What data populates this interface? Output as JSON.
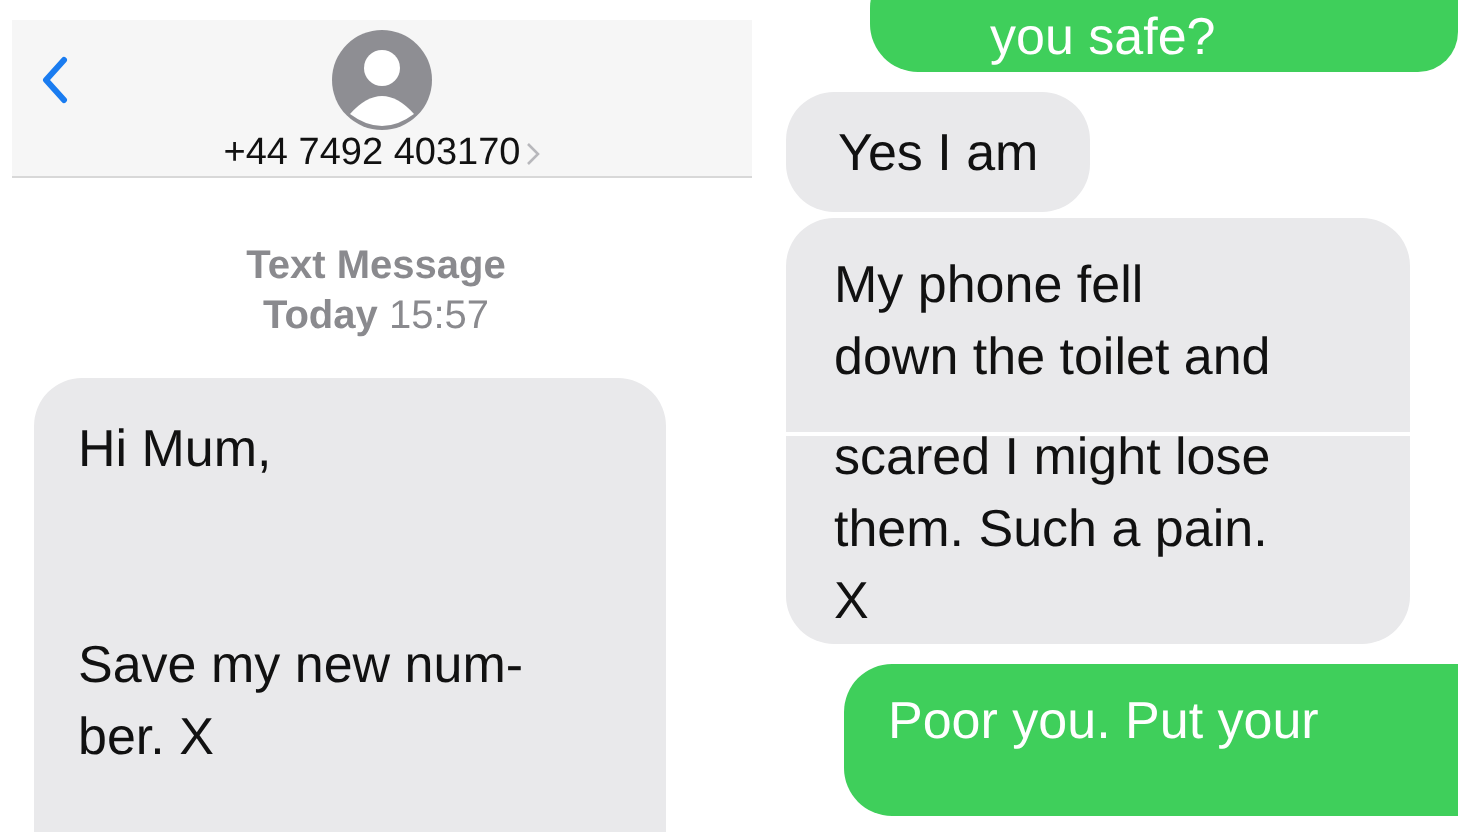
{
  "left_screen": {
    "header": {
      "contact_number": "+44 7492 403170"
    },
    "meta": {
      "service": "Text Message",
      "day": "Today",
      "time": "15:57"
    },
    "messages": [
      {
        "kind": "incoming",
        "paragraphs": [
          [
            "Hi Mum,"
          ],
          [
            "Save my new num-",
            "ber. X"
          ]
        ]
      }
    ]
  },
  "right_screen": {
    "strips": [
      {
        "messages": [
          {
            "kind": "outgoing",
            "paragraphs": [
              [
                "you safe?"
              ]
            ]
          },
          {
            "kind": "incoming",
            "paragraphs": [
              [
                "Yes I am"
              ]
            ]
          },
          {
            "kind": "incoming",
            "paragraphs": [
              [
                "My phone fell",
                "down the toilet and"
              ]
            ]
          }
        ]
      },
      {
        "messages": [
          {
            "kind": "incoming",
            "paragraphs": [
              [
                "scared I might lose",
                "them. Such a pain.",
                "X"
              ]
            ]
          },
          {
            "kind": "outgoing",
            "paragraphs": [
              [
                "Poor you. Put your"
              ]
            ]
          }
        ]
      }
    ]
  }
}
